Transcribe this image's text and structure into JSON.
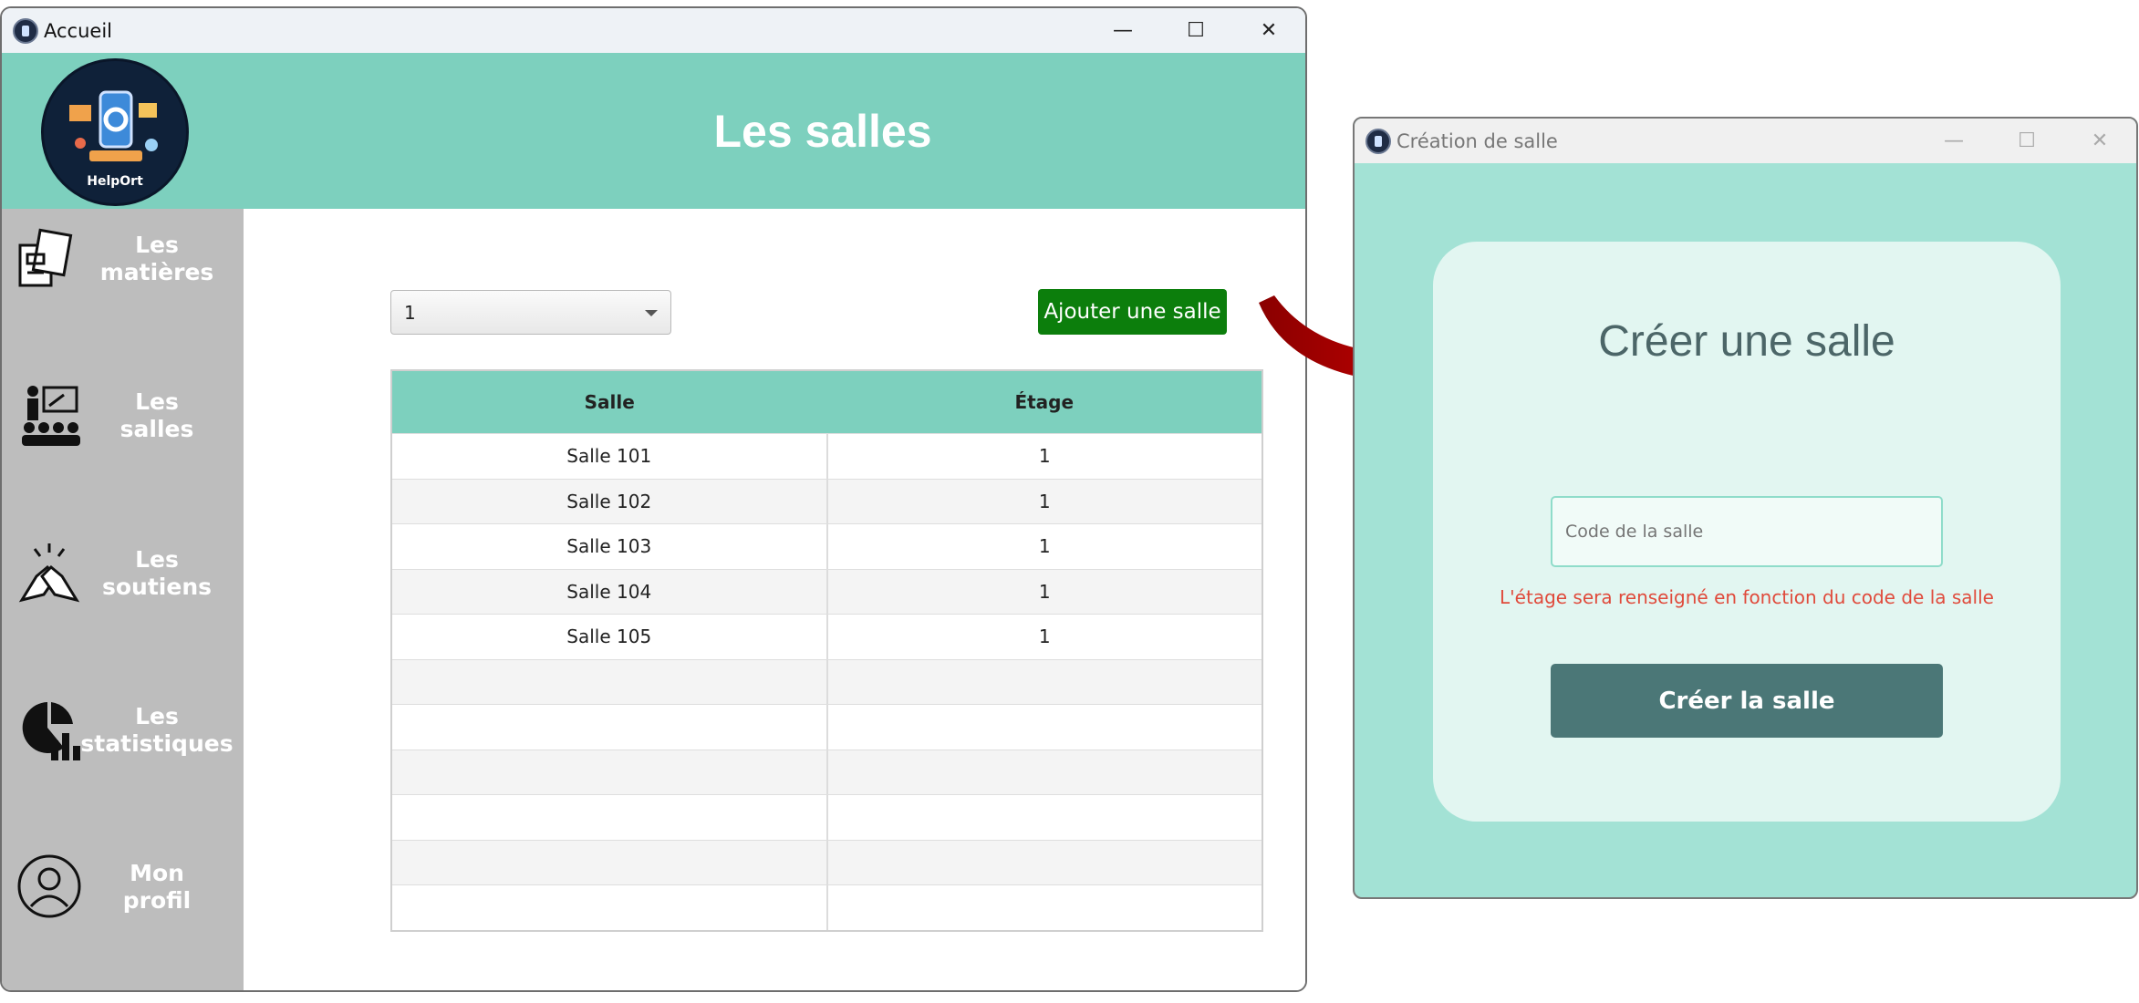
{
  "main_window": {
    "title": "Accueil",
    "controls": {
      "minimize": "—",
      "maximize": "☐",
      "close": "✕"
    },
    "header_title": "Les salles",
    "logo_text": "HelpOrt",
    "sidebar": [
      {
        "label": "Les\nmatières",
        "icon": "books-icon"
      },
      {
        "label": "Les\nsalles",
        "icon": "classroom-icon"
      },
      {
        "label": "Les\nsoutiens",
        "icon": "handshake-icon"
      },
      {
        "label": "Les\nstatistiques",
        "icon": "chart-icon"
      },
      {
        "label": "Mon\nprofil",
        "icon": "profile-icon"
      }
    ],
    "floor_select": {
      "value": "1"
    },
    "add_button": "Ajouter une salle",
    "table": {
      "headers": [
        "Salle",
        "Étage"
      ],
      "rows": [
        [
          "Salle 101",
          "1"
        ],
        [
          "Salle 102",
          "1"
        ],
        [
          "Salle 103",
          "1"
        ],
        [
          "Salle 104",
          "1"
        ],
        [
          "Salle 105",
          "1"
        ],
        [
          "",
          ""
        ],
        [
          "",
          ""
        ],
        [
          "",
          ""
        ],
        [
          "",
          ""
        ],
        [
          "",
          ""
        ],
        [
          "",
          ""
        ]
      ]
    }
  },
  "dialog_window": {
    "title": "Création de salle",
    "controls": {
      "minimize": "—",
      "maximize": "☐",
      "close": "✕"
    },
    "heading": "Créer une salle",
    "code_input": {
      "placeholder": "Code de la salle",
      "value": ""
    },
    "hint": "L'étage sera renseigné en fonction du code de la salle",
    "submit": "Créer la salle"
  },
  "colors": {
    "header": "#7dd0be",
    "sidebar": "#bdbdbd",
    "add_button": "#0c7e0c",
    "dialog_bg": "#a3e2d5",
    "dialog_card": "#e2f6f1",
    "submit_button": "#4b7777",
    "hint_text": "#e04a3b",
    "arrow": "#c40000"
  }
}
